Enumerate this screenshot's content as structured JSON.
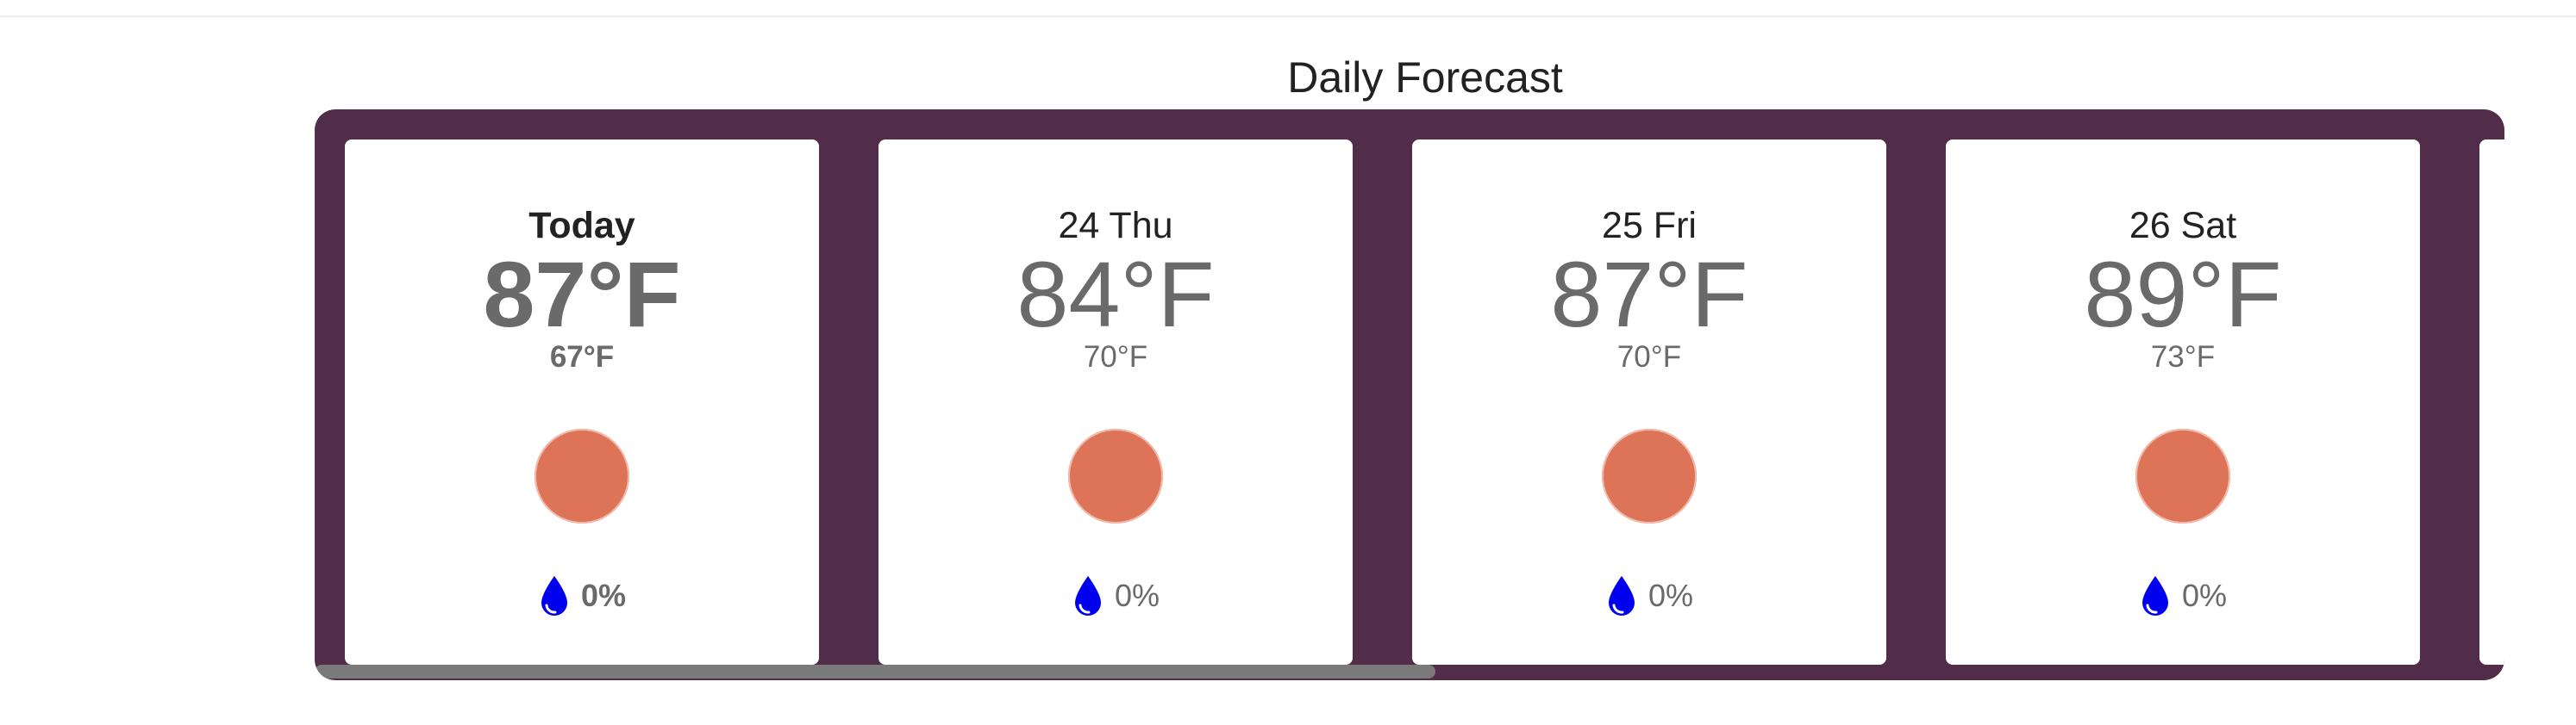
{
  "section": {
    "title": "Daily Forecast"
  },
  "forecast": {
    "days": [
      {
        "day": "Today",
        "high": "87°F",
        "low": "67°F",
        "icon": "sun-icon",
        "precip_icon": "raindrop-icon",
        "precip": "0%"
      },
      {
        "day": "24 Thu",
        "high": "84°F",
        "low": "70°F",
        "icon": "sun-icon",
        "precip_icon": "raindrop-icon",
        "precip": "0%"
      },
      {
        "day": "25 Fri",
        "high": "87°F",
        "low": "70°F",
        "icon": "sun-icon",
        "precip_icon": "raindrop-icon",
        "precip": "0%"
      },
      {
        "day": "26 Sat",
        "high": "89°F",
        "low": "73°F",
        "icon": "sun-icon",
        "precip_icon": "raindrop-icon",
        "precip": "0%"
      }
    ]
  },
  "colors": {
    "panel_background": "#512d4a",
    "sun": "#dd7457",
    "raindrop": "#0000ee",
    "scrollbar": "#7a7a7a"
  }
}
